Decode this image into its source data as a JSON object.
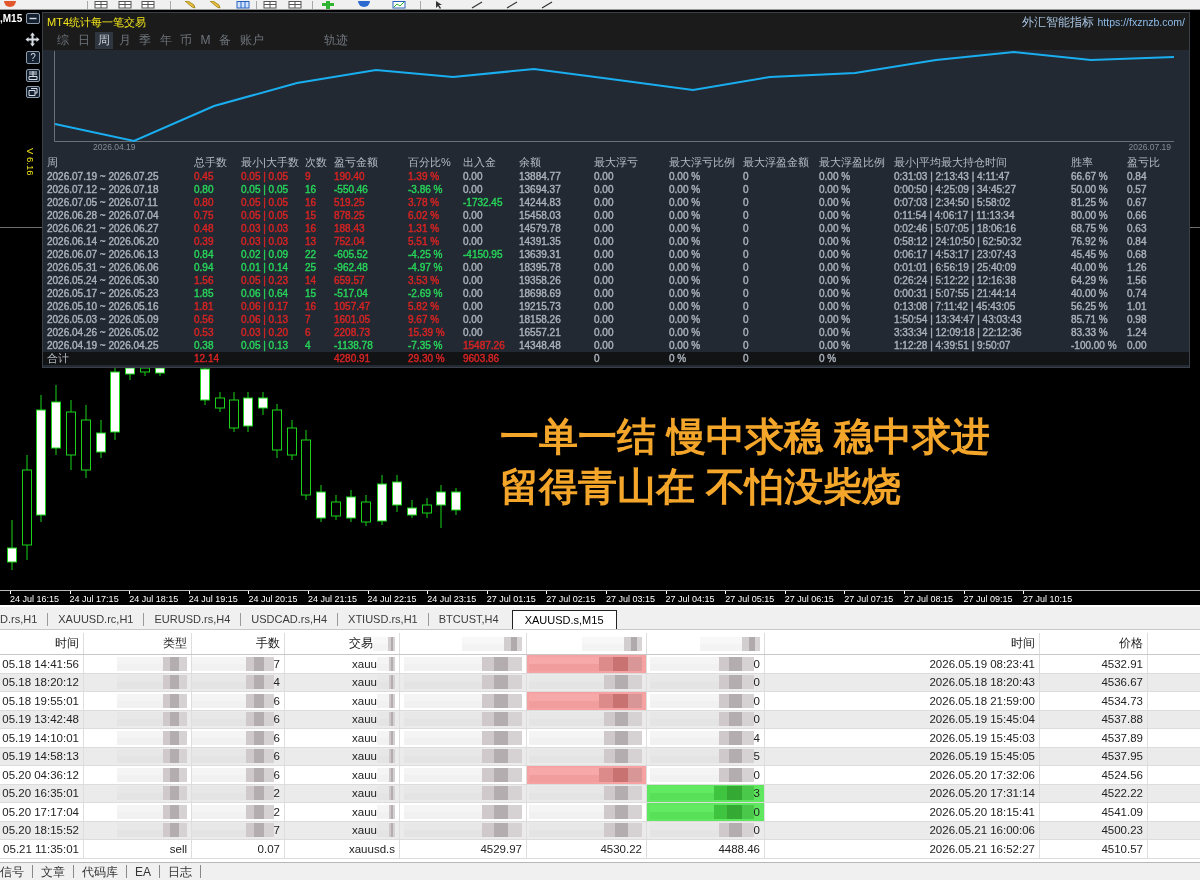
{
  "chart": {
    "symbol_label": ",M15",
    "help_label": "?",
    "version": "V 6.16",
    "caption_lines": [
      "一单一结 慢中求稳 稳中求进",
      "留得青山在 不怕没柴烧"
    ],
    "time_axis": [
      "24 Jul 16:15",
      "24 Jul 17:15",
      "24 Jul 18:15",
      "24 Jul 19:15",
      "24 Jul 20:15",
      "24 Jul 21:15",
      "24 Jul 22:15",
      "24 Jul 23:15",
      "27 Jul 01:15",
      "27 Jul 02:15",
      "27 Jul 03:15",
      "27 Jul 04:15",
      "27 Jul 05:15",
      "27 Jul 06:15",
      "27 Jul 07:15",
      "27 Jul 08:15",
      "27 Jul 09:15",
      "27 Jul 10:15"
    ]
  },
  "stats": {
    "title": "MT4统计每一笔交易",
    "brand": "外汇智能指标",
    "link": "https://fxznzb.com/",
    "tabs": [
      {
        "label": "综",
        "selected": false
      },
      {
        "label": "日",
        "selected": false
      },
      {
        "label": "周",
        "selected": true
      },
      {
        "label": "月",
        "selected": false
      },
      {
        "label": "季",
        "selected": false
      },
      {
        "label": "年",
        "selected": false
      },
      {
        "label": "币",
        "selected": false
      },
      {
        "label": "M",
        "selected": false
      },
      {
        "label": "备",
        "selected": false
      },
      {
        "label": "账户",
        "selected": false
      },
      {
        "label": "轨迹",
        "selected": false
      }
    ],
    "curve": {
      "start_label": "2026.04.19",
      "end_label": "2026.07.19"
    },
    "columns": [
      "周",
      "总手数",
      "最小|大手数",
      "次数",
      "盈亏金额",
      "百分比%",
      "出入金",
      "余额",
      "最大浮亏",
      "最大浮亏比例",
      "最大浮盈金额",
      "最大浮盈比例",
      "最小|平均最大持仓时间",
      "胜率",
      "盈亏比"
    ],
    "rows": [
      {
        "week": "2026.07.19 ~ 2026.07.25",
        "lots": "0.45",
        "lot_range": "0.05 | 0.05",
        "trades": "9",
        "profit": "190.40",
        "percent": "1.39 %",
        "flow": {
          "text": "0.00",
          "color": "#a9b1bb"
        },
        "balance": "13884.77",
        "max_float_loss": "0.00",
        "max_float_loss_pct": "0.00 %",
        "max_float_profit": "0",
        "max_float_profit_pct": "0.00 %",
        "hold_times": "0:31:03 | 2:13:43 | 4:11:47",
        "win_rate": "66.67 %",
        "profit_factor": "0.84",
        "color": "#d92323"
      },
      {
        "week": "2026.07.12 ~ 2026.07.18",
        "lots": "0.80",
        "lot_range": "0.05 | 0.05",
        "trades": "16",
        "profit": "-550.46",
        "percent": "-3.86 %",
        "flow": {
          "text": "0.00",
          "color": "#a9b1bb"
        },
        "balance": "13694.37",
        "max_float_loss": "0.00",
        "max_float_loss_pct": "0.00 %",
        "max_float_profit": "0",
        "max_float_profit_pct": "0.00 %",
        "hold_times": "0:00:50 | 4:25:09 | 34:45:27",
        "win_rate": "50.00 %",
        "profit_factor": "0.57",
        "color": "#27d35a"
      },
      {
        "week": "2026.07.05 ~ 2026.07.11",
        "lots": "0.80",
        "lot_range": "0.05 | 0.05",
        "trades": "16",
        "profit": "519.25",
        "percent": "3.78 %",
        "flow": {
          "text": "-1732.45",
          "color": "#27d35a"
        },
        "balance": "14244.83",
        "max_float_loss": "0.00",
        "max_float_loss_pct": "0.00 %",
        "max_float_profit": "0",
        "max_float_profit_pct": "0.00 %",
        "hold_times": "0:07:03 | 2:34:50 | 5:58:02",
        "win_rate": "81.25 %",
        "profit_factor": "0.67",
        "color": "#d92323"
      },
      {
        "week": "2026.06.28 ~ 2026.07.04",
        "lots": "0.75",
        "lot_range": "0.05 | 0.05",
        "trades": "15",
        "profit": "878.25",
        "percent": "6.02 %",
        "flow": {
          "text": "0.00",
          "color": "#a9b1bb"
        },
        "balance": "15458.03",
        "max_float_loss": "0.00",
        "max_float_loss_pct": "0.00 %",
        "max_float_profit": "0",
        "max_float_profit_pct": "0.00 %",
        "hold_times": "0:11:54 | 4:06:17 | 11:13:34",
        "win_rate": "80.00 %",
        "profit_factor": "0.66",
        "color": "#d92323"
      },
      {
        "week": "2026.06.21 ~ 2026.06.27",
        "lots": "0.48",
        "lot_range": "0.03 | 0.03",
        "trades": "16",
        "profit": "188.43",
        "percent": "1.31 %",
        "flow": {
          "text": "0.00",
          "color": "#a9b1bb"
        },
        "balance": "14579.78",
        "max_float_loss": "0.00",
        "max_float_loss_pct": "0.00 %",
        "max_float_profit": "0",
        "max_float_profit_pct": "0.00 %",
        "hold_times": "0:02:46 | 5:07:05 | 18:06:16",
        "win_rate": "68.75 %",
        "profit_factor": "0.63",
        "color": "#d92323"
      },
      {
        "week": "2026.06.14 ~ 2026.06.20",
        "lots": "0.39",
        "lot_range": "0.03 | 0.03",
        "trades": "13",
        "profit": "752.04",
        "percent": "5.51 %",
        "flow": {
          "text": "0.00",
          "color": "#a9b1bb"
        },
        "balance": "14391.35",
        "max_float_loss": "0.00",
        "max_float_loss_pct": "0.00 %",
        "max_float_profit": "0",
        "max_float_profit_pct": "0.00 %",
        "hold_times": "0:58:12 | 24:10:50 | 62:50:32",
        "win_rate": "76.92 %",
        "profit_factor": "0.84",
        "color": "#d92323"
      },
      {
        "week": "2026.06.07 ~ 2026.06.13",
        "lots": "0.84",
        "lot_range": "0.02 | 0.09",
        "trades": "22",
        "profit": "-605.52",
        "percent": "-4.25 %",
        "flow": {
          "text": "-4150.95",
          "color": "#27d35a"
        },
        "balance": "13639.31",
        "max_float_loss": "0.00",
        "max_float_loss_pct": "0.00 %",
        "max_float_profit": "0",
        "max_float_profit_pct": "0.00 %",
        "hold_times": "0:06:17 | 4:53:17 | 23:07:43",
        "win_rate": "45.45 %",
        "profit_factor": "0.68",
        "color": "#27d35a"
      },
      {
        "week": "2026.05.31 ~ 2026.06.06",
        "lots": "0.94",
        "lot_range": "0.01 | 0.14",
        "trades": "25",
        "profit": "-962.48",
        "percent": "-4.97 %",
        "flow": {
          "text": "0.00",
          "color": "#a9b1bb"
        },
        "balance": "18395.78",
        "max_float_loss": "0.00",
        "max_float_loss_pct": "0.00 %",
        "max_float_profit": "0",
        "max_float_profit_pct": "0.00 %",
        "hold_times": "0:01:01 | 6:56:19 | 25:40:09",
        "win_rate": "40.00 %",
        "profit_factor": "1.26",
        "color": "#27d35a"
      },
      {
        "week": "2026.05.24 ~ 2026.05.30",
        "lots": "1.56",
        "lot_range": "0.05 | 0.23",
        "trades": "14",
        "profit": "659.57",
        "percent": "3.53 %",
        "flow": {
          "text": "0.00",
          "color": "#a9b1bb"
        },
        "balance": "19358.26",
        "max_float_loss": "0.00",
        "max_float_loss_pct": "0.00 %",
        "max_float_profit": "0",
        "max_float_profit_pct": "0.00 %",
        "hold_times": "0:26:24 | 5:12:22 | 12:16:38",
        "win_rate": "64.29 %",
        "profit_factor": "1.56",
        "color": "#d92323"
      },
      {
        "week": "2026.05.17 ~ 2026.05.23",
        "lots": "1.85",
        "lot_range": "0.06 | 0.64",
        "trades": "15",
        "profit": "-517.04",
        "percent": "-2.69 %",
        "flow": {
          "text": "0.00",
          "color": "#a9b1bb"
        },
        "balance": "18698.69",
        "max_float_loss": "0.00",
        "max_float_loss_pct": "0.00 %",
        "max_float_profit": "0",
        "max_float_profit_pct": "0.00 %",
        "hold_times": "0:00:31 | 5:07:55 | 21:44:14",
        "win_rate": "40.00 %",
        "profit_factor": "0.74",
        "color": "#27d35a"
      },
      {
        "week": "2026.05.10 ~ 2026.05.16",
        "lots": "1.81",
        "lot_range": "0.06 | 0.17",
        "trades": "16",
        "profit": "1057.47",
        "percent": "5.82 %",
        "flow": {
          "text": "0.00",
          "color": "#a9b1bb"
        },
        "balance": "19215.73",
        "max_float_loss": "0.00",
        "max_float_loss_pct": "0.00 %",
        "max_float_profit": "0",
        "max_float_profit_pct": "0.00 %",
        "hold_times": "0:13:08 | 7:11:42 | 45:43:05",
        "win_rate": "56.25 %",
        "profit_factor": "1.01",
        "color": "#d92323"
      },
      {
        "week": "2026.05.03 ~ 2026.05.09",
        "lots": "0.56",
        "lot_range": "0.06 | 0.13",
        "trades": "7",
        "profit": "1601.05",
        "percent": "9.67 %",
        "flow": {
          "text": "0.00",
          "color": "#a9b1bb"
        },
        "balance": "18158.26",
        "max_float_loss": "0.00",
        "max_float_loss_pct": "0.00 %",
        "max_float_profit": "0",
        "max_float_profit_pct": "0.00 %",
        "hold_times": "1:50:54 | 13:34:47 | 43:03:43",
        "win_rate": "85.71 %",
        "profit_factor": "0.98",
        "color": "#d92323"
      },
      {
        "week": "2026.04.26 ~ 2026.05.02",
        "lots": "0.53",
        "lot_range": "0.03 | 0.20",
        "trades": "6",
        "profit": "2208.73",
        "percent": "15.39 %",
        "flow": {
          "text": "0.00",
          "color": "#a9b1bb"
        },
        "balance": "16557.21",
        "max_float_loss": "0.00",
        "max_float_loss_pct": "0.00 %",
        "max_float_profit": "0",
        "max_float_profit_pct": "0.00 %",
        "hold_times": "3:33:34 | 12:09:18 | 22:12:36",
        "win_rate": "83.33 %",
        "profit_factor": "1.24",
        "color": "#d92323"
      },
      {
        "week": "2026.04.19 ~ 2026.04.25",
        "lots": "0.38",
        "lot_range": "0.05 | 0.13",
        "trades": "4",
        "profit": "-1138.78",
        "percent": "-7.35 %",
        "flow": {
          "text": "15487.26",
          "color": "#d92323"
        },
        "balance": "14348.48",
        "max_float_loss": "0.00",
        "max_float_loss_pct": "0.00 %",
        "max_float_profit": "0",
        "max_float_profit_pct": "0.00 %",
        "hold_times": "1:12:28 | 4:39:51 | 9:50:07",
        "win_rate": "-100.00 %",
        "profit_factor": "0.00",
        "color": "#27d35a"
      }
    ],
    "total": {
      "label": "合计",
      "lots": "12.14",
      "profit": "4280.91",
      "percent": "29.30 %",
      "flow": "9603.86",
      "max_float_loss": "0",
      "max_float_loss_pct": "0 %",
      "max_float_profit": "0",
      "max_float_profit_pct": "0 %",
      "color": "#d92323"
    }
  },
  "chart_tabs": [
    {
      "label": "D.rs,H1",
      "selected": false
    },
    {
      "label": "XAUUSD.rc,H1",
      "selected": false
    },
    {
      "label": "EURUSD.rs,H4",
      "selected": false
    },
    {
      "label": "USDCAD.rs,H4",
      "selected": false
    },
    {
      "label": "XTIUSD.rs,H1",
      "selected": false
    },
    {
      "label": "BTCUST,H4",
      "selected": false
    },
    {
      "label": "XAUUSD.s,M15",
      "selected": true
    }
  ],
  "terminal": {
    "columns": [
      {
        "kind": "text",
        "label": "时间"
      },
      {
        "kind": "text",
        "label": "类型"
      },
      {
        "kind": "text",
        "label": "手数"
      },
      {
        "kind": "partial",
        "label": "交易"
      },
      {
        "kind": "masked"
      },
      {
        "kind": "masked"
      },
      {
        "kind": "masked"
      },
      {
        "kind": "text",
        "label": "时间"
      },
      {
        "kind": "text",
        "label": "价格"
      }
    ],
    "rows": [
      {
        "kind": "masked",
        "time": "05.18 14:41:56",
        "lots": "7",
        "symbol": "xauu",
        "tp": "0",
        "close_time": "2026.05.19 08:23:41",
        "close_price": "4532.91",
        "sl_hit": true,
        "tp_hit": false
      },
      {
        "kind": "masked",
        "time": "05.18 18:20:12",
        "lots": "4",
        "symbol": "xauu",
        "tp": "0",
        "close_time": "2026.05.18 18:20:43",
        "close_price": "4536.67",
        "sl_hit": false,
        "tp_hit": false
      },
      {
        "kind": "masked",
        "time": "05.18 19:55:01",
        "lots": "6",
        "symbol": "xauu",
        "tp": "0",
        "close_time": "2026.05.18 21:59:00",
        "close_price": "4534.73",
        "sl_hit": true,
        "tp_hit": false
      },
      {
        "kind": "masked",
        "time": "05.19 13:42:48",
        "lots": "6",
        "symbol": "xauu",
        "tp": "0",
        "close_time": "2026.05.19 15:45:04",
        "close_price": "4537.88",
        "sl_hit": false,
        "tp_hit": false
      },
      {
        "kind": "masked",
        "time": "05.19 14:10:01",
        "lots": "6",
        "symbol": "xauu",
        "tp": "4",
        "close_time": "2026.05.19 15:45:03",
        "close_price": "4537.89",
        "sl_hit": false,
        "tp_hit": false
      },
      {
        "kind": "masked",
        "time": "05.19 14:58:13",
        "lots": "6",
        "symbol": "xauu",
        "tp": "5",
        "close_time": "2026.05.19 15:45:05",
        "close_price": "4537.95",
        "sl_hit": false,
        "tp_hit": false
      },
      {
        "kind": "masked",
        "time": "05.20 04:36:12",
        "lots": "6",
        "symbol": "xauu",
        "tp": "0",
        "close_time": "2026.05.20 17:32:06",
        "close_price": "4524.56",
        "sl_hit": true,
        "tp_hit": false
      },
      {
        "kind": "masked",
        "time": "05.20 16:35:01",
        "lots": "2",
        "symbol": "xauu",
        "tp": "3",
        "close_time": "2026.05.20 17:31:14",
        "close_price": "4522.22",
        "sl_hit": false,
        "tp_hit": true
      },
      {
        "kind": "masked",
        "time": "05.20 17:17:04",
        "lots": "2",
        "symbol": "xauu",
        "tp": "0",
        "close_time": "2026.05.20 18:15:41",
        "close_price": "4541.09",
        "sl_hit": false,
        "tp_hit": true
      },
      {
        "kind": "masked",
        "time": "05.20 18:15:52",
        "lots": "7",
        "symbol": "xauu",
        "tp": "0",
        "close_time": "2026.05.21 16:00:06",
        "close_price": "4500.23",
        "sl_hit": false,
        "tp_hit": false
      },
      {
        "kind": "plain",
        "time": "05.21 11:35:01",
        "type": "sell",
        "lots": "0.07",
        "symbol": "xauusd.s",
        "open_price": "4529.97",
        "sl": "4530.22",
        "tp": "4488.46",
        "close_time": "2026.05.21 16:52:27",
        "close_price": "4510.57",
        "sl_hit": false,
        "tp_hit": false
      }
    ]
  },
  "bottom_tabs": [
    {
      "label": "信号",
      "selected": false
    },
    {
      "label": "文章",
      "selected": false
    },
    {
      "label": "代码库",
      "selected": false
    },
    {
      "label": "EA",
      "selected": false
    },
    {
      "label": "日志",
      "selected": false
    }
  ]
}
